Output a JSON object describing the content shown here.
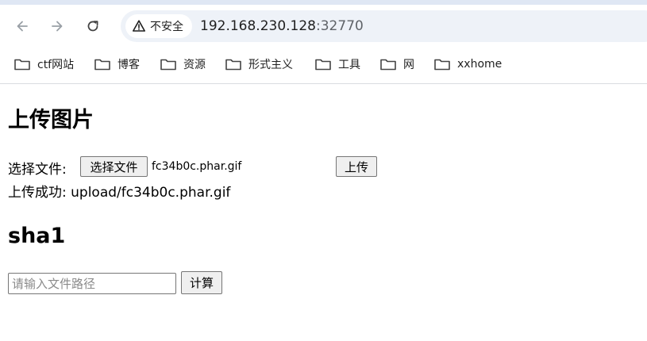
{
  "browser": {
    "security_label": "不安全",
    "url_host": "192.168.230.128",
    "url_port": ":32770",
    "bookmarks": [
      {
        "label": "ctf网站"
      },
      {
        "label": "博客"
      },
      {
        "label": "资源"
      },
      {
        "label": "形式主义"
      },
      {
        "label": "工具"
      },
      {
        "label": "网"
      },
      {
        "label": "xxhome"
      }
    ]
  },
  "upload": {
    "heading": "上传图片",
    "file_label": "选择文件:",
    "choose_button": "选择文件",
    "selected_file": "fc34b0c.phar.gif",
    "upload_button": "上传",
    "success_label": "上传成功: ",
    "success_path": "upload/fc34b0c.phar.gif"
  },
  "sha1": {
    "heading": "sha1",
    "path_placeholder": "请输入文件路径",
    "path_value": "",
    "compute_button": "计算"
  }
}
